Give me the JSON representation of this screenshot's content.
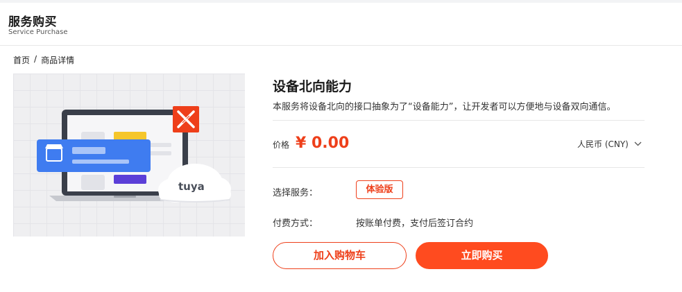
{
  "header": {
    "title": "服务购买",
    "subtitle": "Service Purchase"
  },
  "breadcrumb": {
    "home": "首页",
    "separator": "/",
    "current": "商品详情"
  },
  "hero": {
    "logo_text": "tuya"
  },
  "product": {
    "title": "设备北向能力",
    "description": "本服务将设备北向的接口抽象为了“设备能力”，让开发者可以方便地与设备双向通信。"
  },
  "price": {
    "label": "价格",
    "value": "¥ 0.00",
    "currency": "人民币 (CNY)"
  },
  "service": {
    "label": "选择服务：",
    "option": "体验版"
  },
  "payment": {
    "label": "付费方式：",
    "value": "按账单付费，支付后签订合约"
  },
  "actions": {
    "add_to_cart": "加入购物车",
    "buy_now": "立即购买"
  },
  "colors": {
    "accent": "#ee3f1a",
    "buy_button": "#ff4b1f",
    "card_blue": "#3f7cf0"
  }
}
